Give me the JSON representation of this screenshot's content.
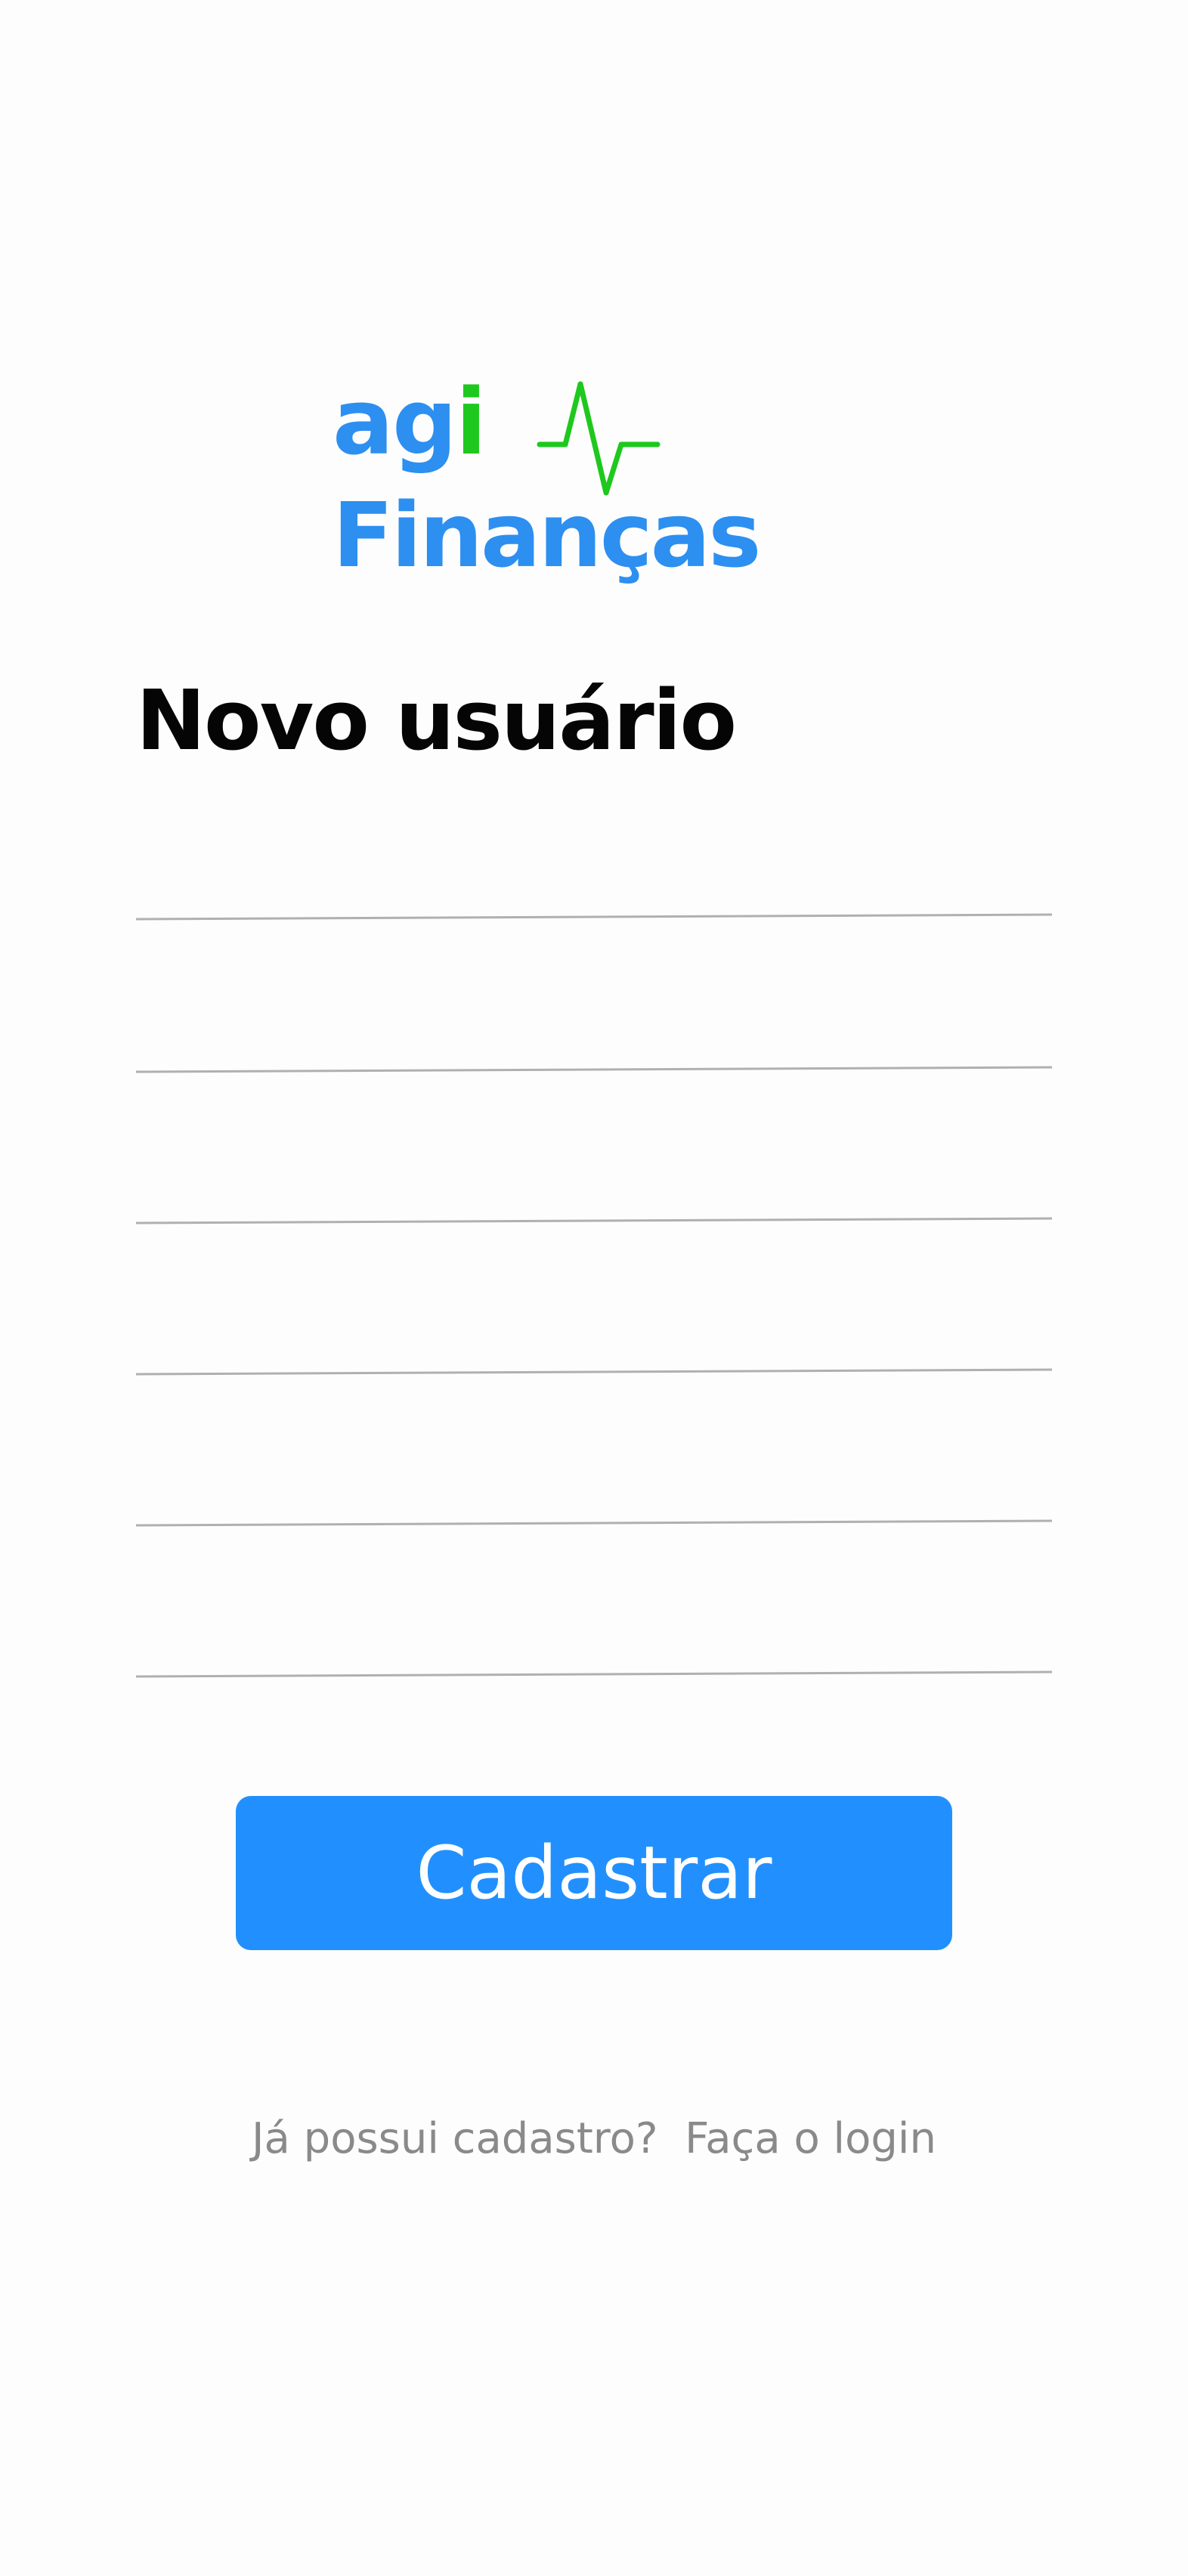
{
  "logo": {
    "part1": "ag",
    "part2": "i",
    "part3": "Finanças",
    "icon": "pulse-icon",
    "colors": {
      "blue": "#2d8ff0",
      "green": "#1ec81e"
    }
  },
  "title": "Novo usuário",
  "form": {
    "fields": [
      {
        "value": "",
        "placeholder": ""
      },
      {
        "value": "",
        "placeholder": ""
      },
      {
        "value": "",
        "placeholder": ""
      },
      {
        "value": "",
        "placeholder": ""
      },
      {
        "value": "",
        "placeholder": ""
      }
    ],
    "submit_label": "Cadastrar",
    "accent_color": "#2190fe",
    "line_color": "#b0b0b0"
  },
  "footer": {
    "question": "Já possui cadastro?",
    "link": "Faça o login"
  }
}
